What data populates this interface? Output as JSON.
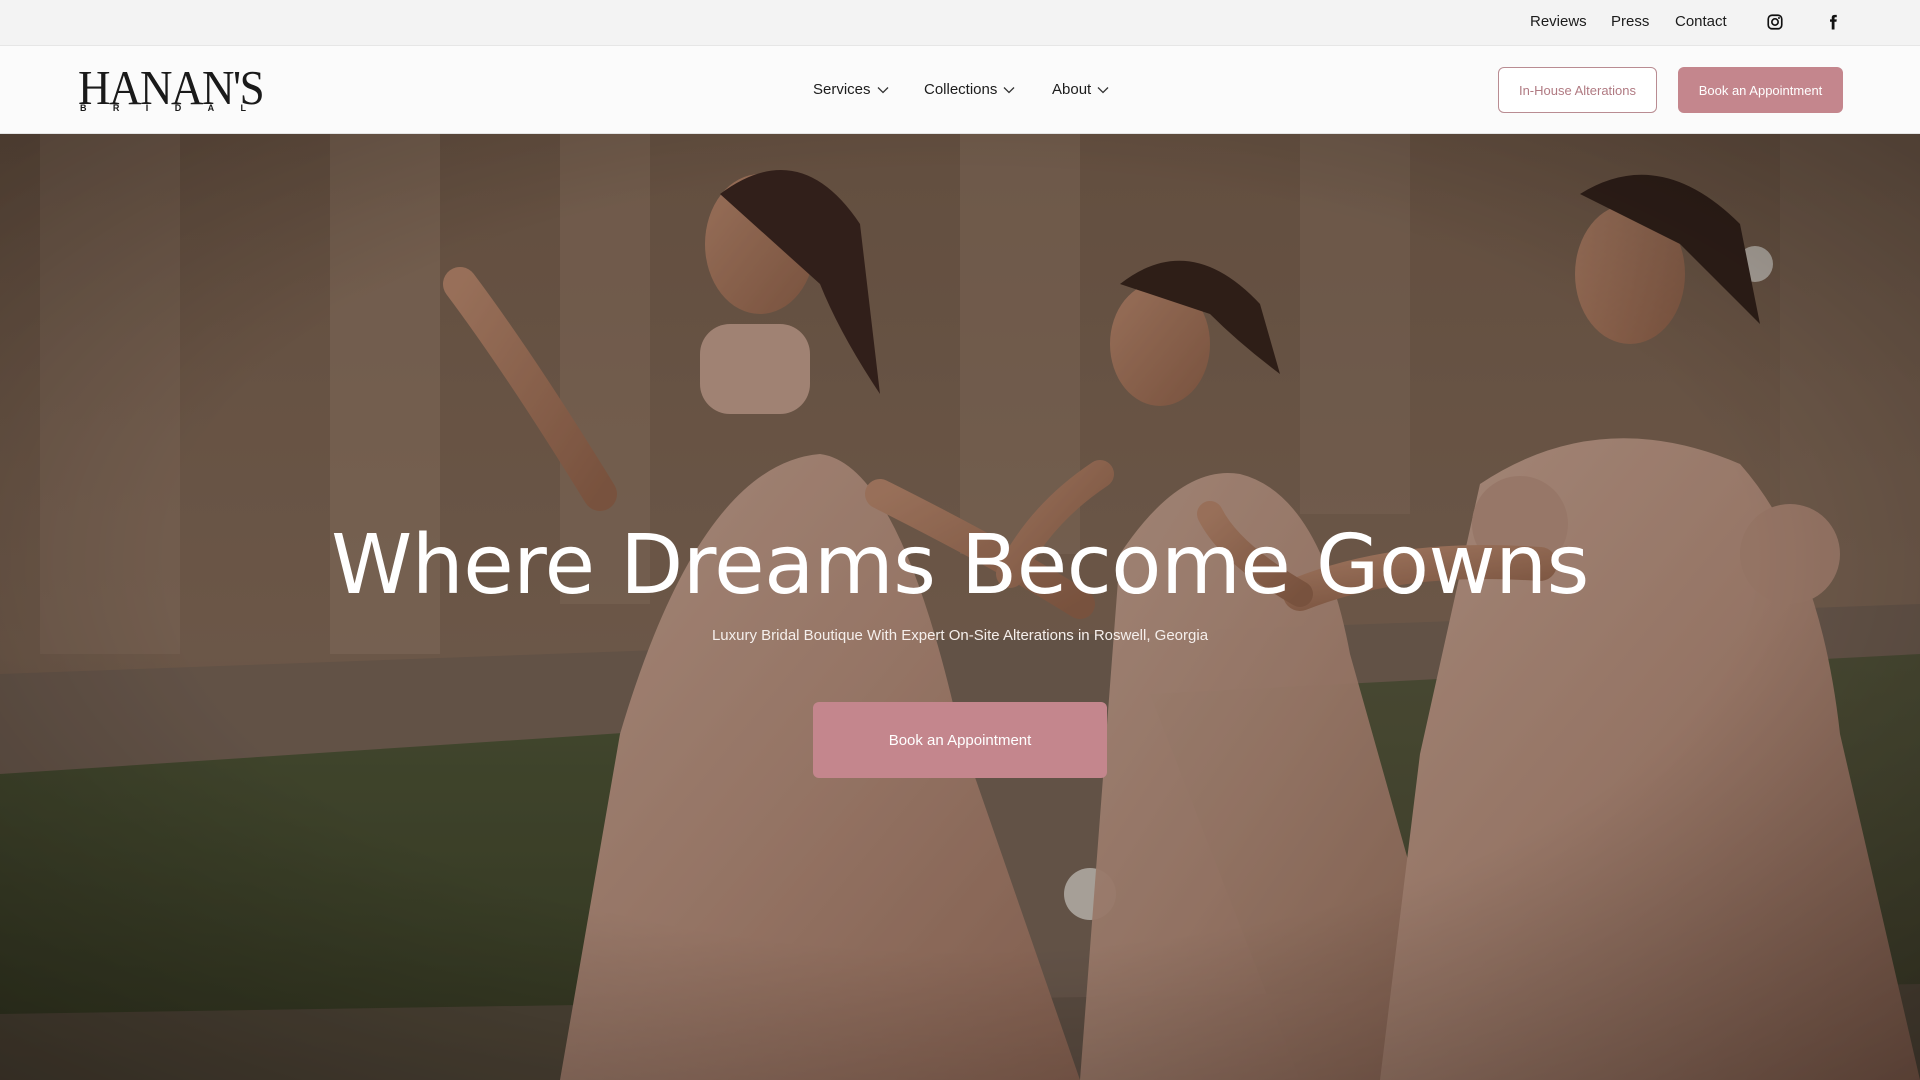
{
  "topbar": {
    "links": [
      "Reviews",
      "Press",
      "Contact"
    ],
    "social": [
      "instagram-icon",
      "facebook-icon"
    ]
  },
  "brand": {
    "name": "HANAN'S",
    "subtitle": "BRIDAL"
  },
  "nav": {
    "items": [
      {
        "label": "Services",
        "icon": "chevron-down-icon"
      },
      {
        "label": "Collections",
        "icon": "chevron-down-icon"
      },
      {
        "label": "About",
        "icon": "chevron-down-icon"
      }
    ],
    "alterations_label": "In-House Alterations",
    "book_label": "Book an Appointment"
  },
  "hero": {
    "title": "Where Dreams Become Gowns",
    "subtitle": "Luxury Bridal Boutique With Expert On-Site Alterations in Roswell, Georgia",
    "cta_label": "Book an Appointment"
  },
  "colors": {
    "accent": "#c4868d",
    "accent_text": "#b07a82",
    "topbar_bg": "#f3f3f3",
    "header_bg": "#fbfbfb"
  }
}
